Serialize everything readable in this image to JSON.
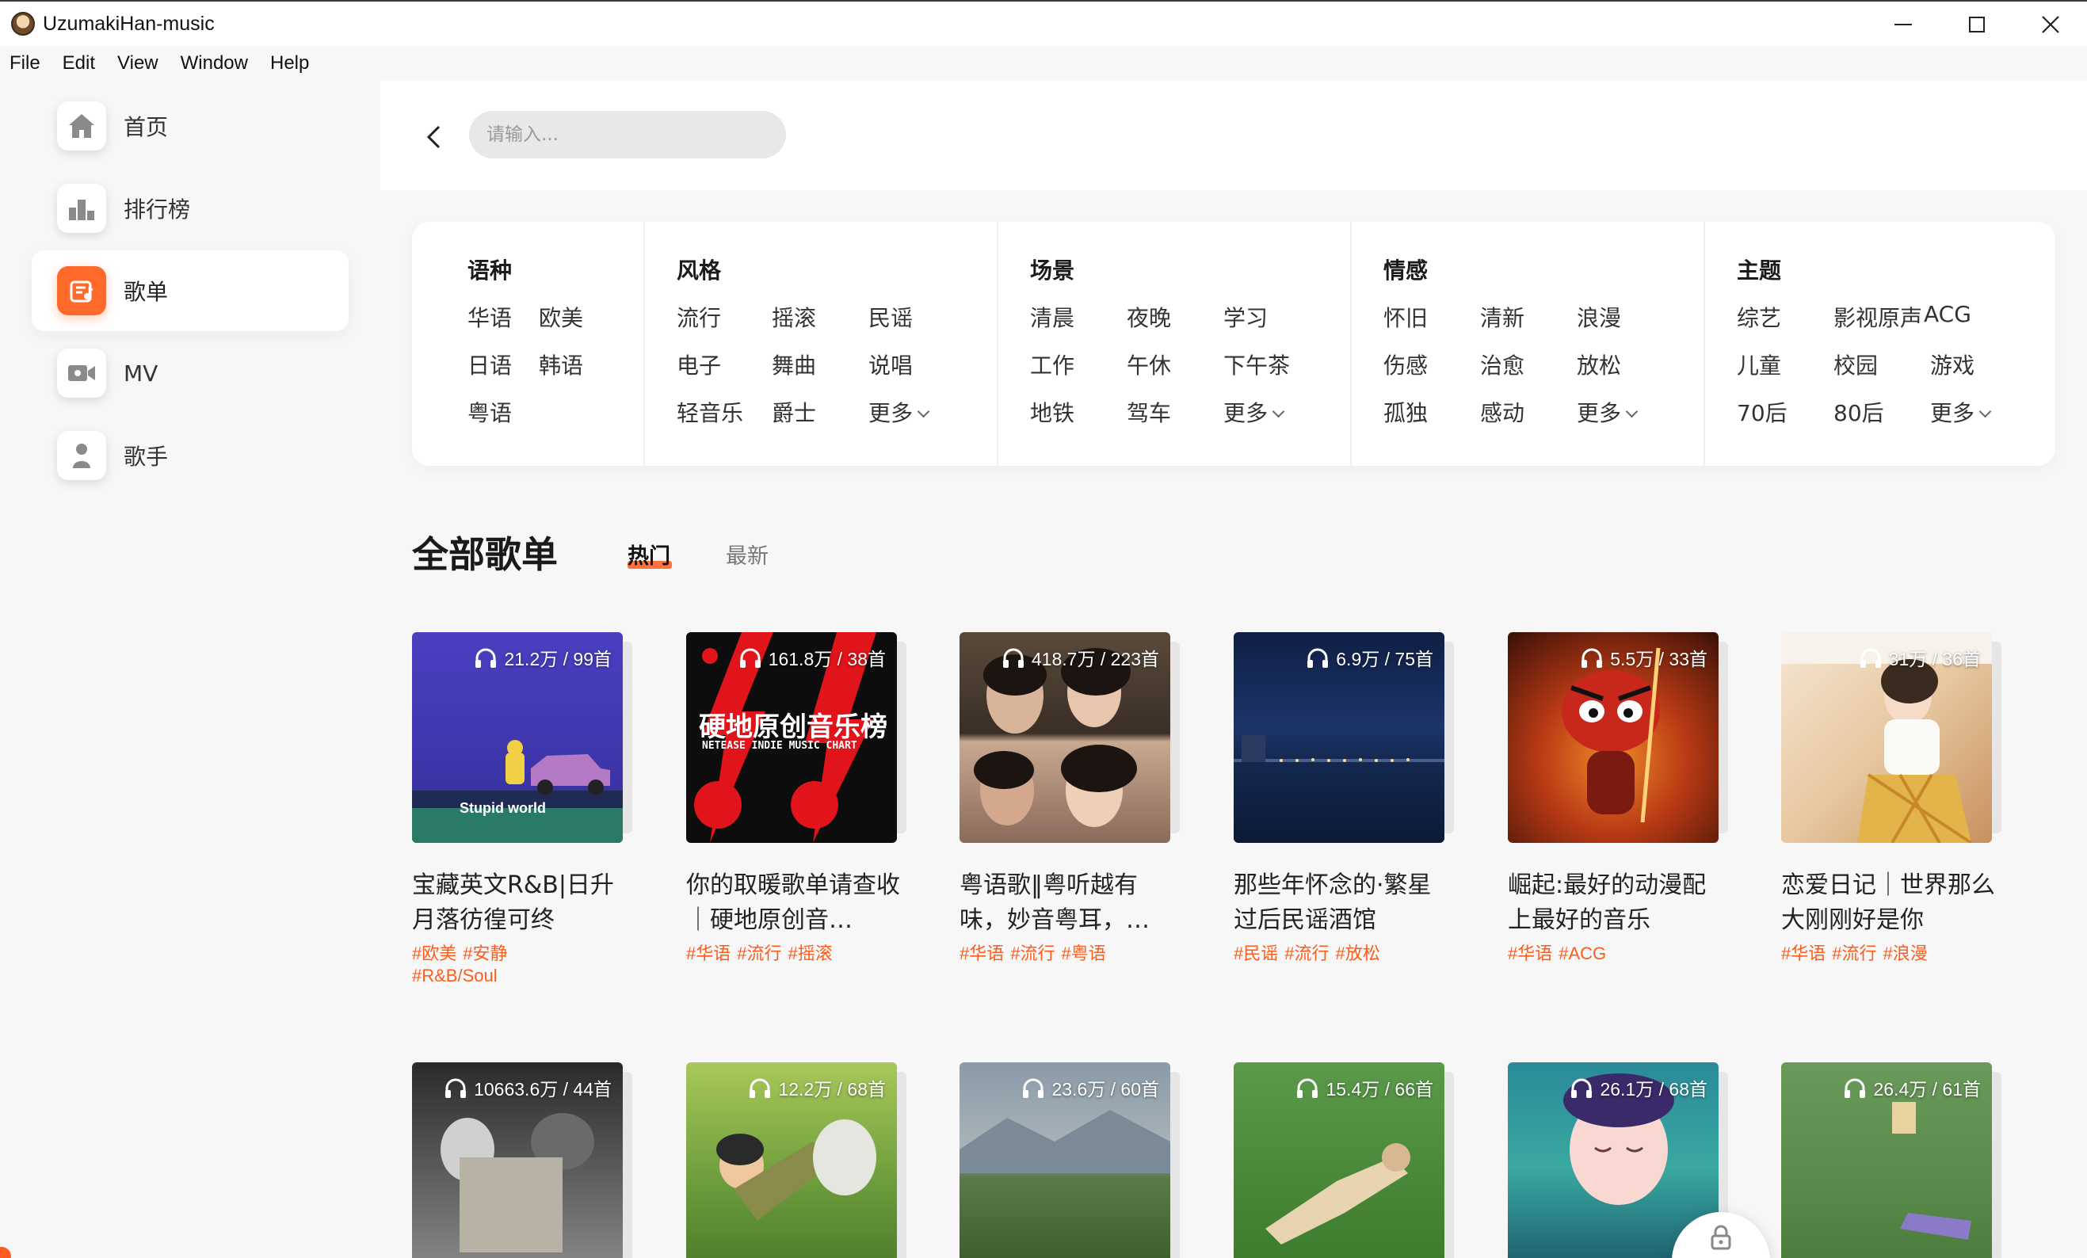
{
  "window": {
    "title": "UzumakiHan-music"
  },
  "menu": [
    "File",
    "Edit",
    "View",
    "Window",
    "Help"
  ],
  "sidebar": {
    "items": [
      {
        "label": "首页",
        "icon": "home-icon"
      },
      {
        "label": "排行榜",
        "icon": "chart-icon"
      },
      {
        "label": "歌单",
        "icon": "playlist-icon",
        "active": true
      },
      {
        "label": "MV",
        "icon": "video-camera-icon"
      },
      {
        "label": "歌手",
        "icon": "person-icon"
      }
    ]
  },
  "search": {
    "placeholder": "请输入..."
  },
  "categories": [
    {
      "title": "语种",
      "tags": [
        "华语",
        "欧美",
        "日语",
        "韩语",
        "粤语"
      ]
    },
    {
      "title": "风格",
      "tags": [
        "流行",
        "摇滚",
        "民谣",
        "电子",
        "舞曲",
        "说唱",
        "轻音乐",
        "爵士",
        "更多"
      ]
    },
    {
      "title": "场景",
      "tags": [
        "清晨",
        "夜晚",
        "学习",
        "工作",
        "午休",
        "下午茶",
        "地铁",
        "驾车",
        "更多"
      ]
    },
    {
      "title": "情感",
      "tags": [
        "怀旧",
        "清新",
        "浪漫",
        "伤感",
        "治愈",
        "放松",
        "孤独",
        "感动",
        "更多"
      ]
    },
    {
      "title": "主题",
      "tags": [
        "综艺",
        "影视原声",
        "ACG",
        "儿童",
        "校园",
        "游戏",
        "70后",
        "80后",
        "更多"
      ]
    }
  ],
  "section": {
    "title": "全部歌单",
    "tab_hot": "热门",
    "tab_new": "最新"
  },
  "playlists": [
    {
      "stat": "21.2万 / 99首",
      "title": "宝藏英文R&B|日升月落彷徨可终",
      "tags": [
        "#欧美",
        "#安静",
        "#R&B/Soul"
      ],
      "cover_caption": "Stupid world"
    },
    {
      "stat": "161.8万 / 38首",
      "title": "你的取暖歌单请查收｜硬地原创音…",
      "tags": [
        "#华语",
        "#流行",
        "#摇滚"
      ],
      "cover_caption": "硬地原创音乐榜",
      "cover_sub": "NETEASE INDIE MUSIC CHART"
    },
    {
      "stat": "418.7万 / 223首",
      "title": "粤语歌‖粤听越有味，妙音粤耳，…",
      "tags": [
        "#华语",
        "#流行",
        "#粤语"
      ]
    },
    {
      "stat": "6.9万 / 75首",
      "title": "那些年怀念的·繁星过后民谣酒馆",
      "tags": [
        "#民谣",
        "#流行",
        "#放松"
      ]
    },
    {
      "stat": "5.5万 / 33首",
      "title": "崛起:最好的动漫配上最好的音乐",
      "tags": [
        "#华语",
        "#ACG"
      ]
    },
    {
      "stat": "31万 / 36首",
      "title": "恋爱日记｜世界那么大刚刚好是你",
      "tags": [
        "#华语",
        "#流行",
        "#浪漫"
      ]
    },
    {
      "stat": "10663.6万 / 44首"
    },
    {
      "stat": "12.2万 / 68首"
    },
    {
      "stat": "23.6万 / 60首"
    },
    {
      "stat": "15.4万 / 66首"
    },
    {
      "stat": "26.1万 / 68首"
    },
    {
      "stat": "26.4万 / 61首"
    }
  ],
  "colors": {
    "accent": "#ff5a1f",
    "tag": "#ff5c1c"
  }
}
